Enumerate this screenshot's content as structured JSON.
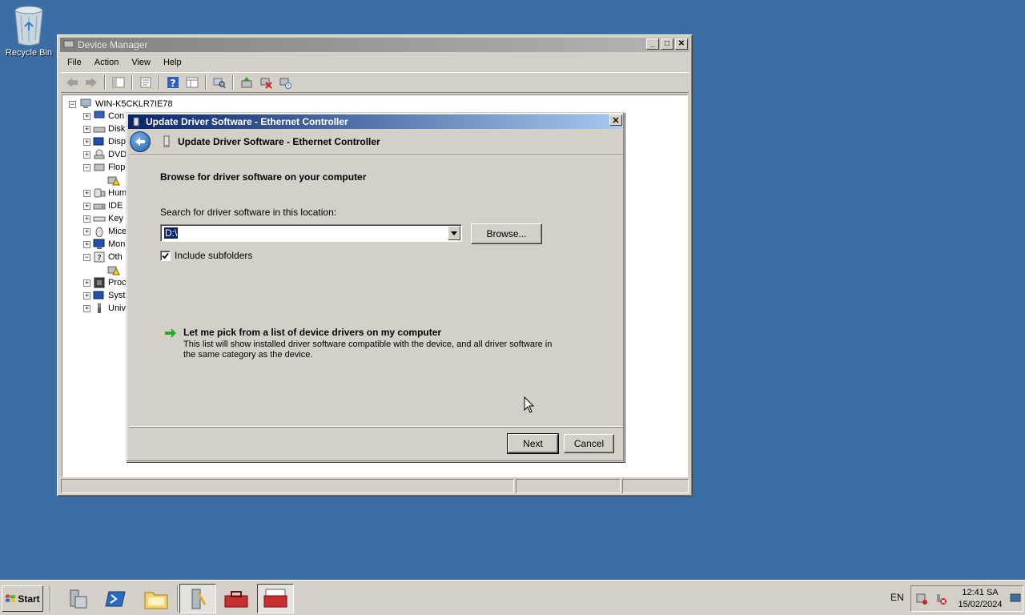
{
  "desktop": {
    "recycle_bin_label": "Recycle Bin"
  },
  "device_manager": {
    "title": "Device Manager",
    "menu": [
      "File",
      "Action",
      "View",
      "Help"
    ],
    "root": "WIN-K5CKLR7IE78",
    "tree": [
      {
        "label": "Con",
        "expander": "+"
      },
      {
        "label": "Disk",
        "expander": "+"
      },
      {
        "label": "Disp",
        "expander": "+"
      },
      {
        "label": "DVD",
        "expander": "+"
      },
      {
        "label": "Flop",
        "expander": "-"
      },
      {
        "label": "",
        "expander": ""
      },
      {
        "label": "Hum",
        "expander": "+"
      },
      {
        "label": "IDE",
        "expander": "+"
      },
      {
        "label": "Key",
        "expander": "+"
      },
      {
        "label": "Mice",
        "expander": "+"
      },
      {
        "label": "Mon",
        "expander": "+"
      },
      {
        "label": "Oth",
        "expander": "-"
      },
      {
        "label": "",
        "expander": ""
      },
      {
        "label": "Proc",
        "expander": "+"
      },
      {
        "label": "Syst",
        "expander": "+"
      },
      {
        "label": "Univ",
        "expander": "+"
      }
    ]
  },
  "dialog": {
    "title": "Update Driver Software - Ethernet Controller",
    "header": "Update Driver Software - Ethernet Controller",
    "heading": "Browse for driver software on your computer",
    "search_label": "Search for driver software in this location:",
    "path_value": "D:\\",
    "browse_label": "Browse...",
    "include_subfolders_label": "Include subfolders",
    "include_subfolders_checked": true,
    "pick_title": "Let me pick from a list of device drivers on my computer",
    "pick_desc": "This list will show installed driver software compatible with the device, and all driver software in the same category as the device.",
    "next_label": "Next",
    "cancel_label": "Cancel"
  },
  "taskbar": {
    "start_label": "Start",
    "language": "EN",
    "time": "12:41 SA",
    "date": "15/02/2024"
  }
}
